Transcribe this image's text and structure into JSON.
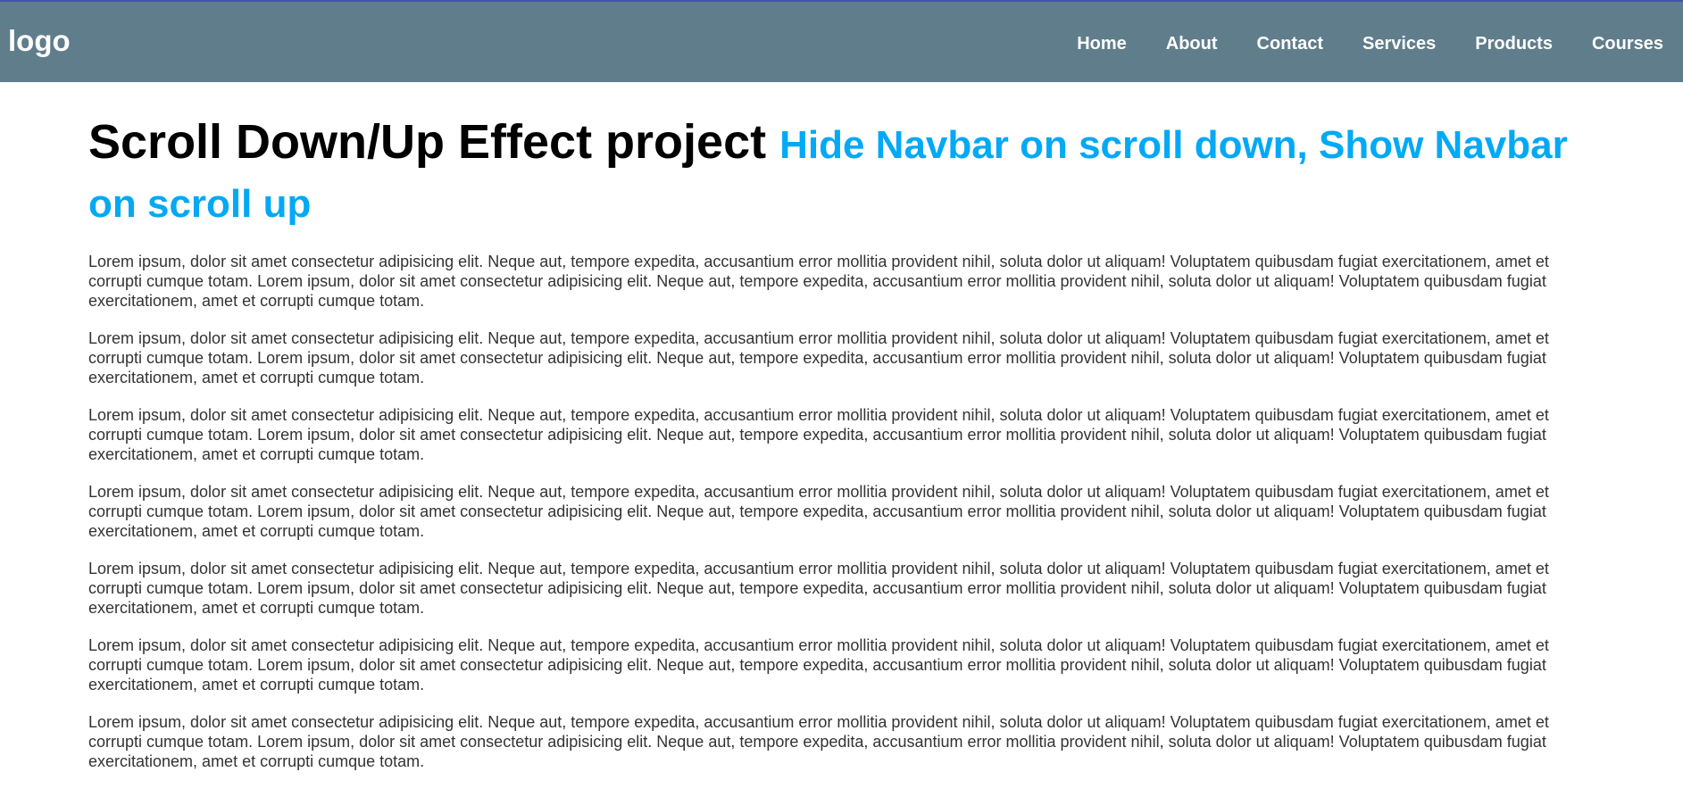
{
  "navbar": {
    "logo": "logo",
    "links": [
      "Home",
      "About",
      "Contact",
      "Services",
      "Products",
      "Courses"
    ]
  },
  "main": {
    "title": "Scroll Down/Up Effect project",
    "subtitle": "Hide Navbar on scroll down, Show Navbar on scroll up",
    "paragraphs": [
      "Lorem ipsum, dolor sit amet consectetur adipisicing elit. Neque aut, tempore expedita, accusantium error mollitia provident nihil, soluta dolor ut aliquam! Voluptatem quibusdam fugiat exercitationem, amet et corrupti cumque totam. Lorem ipsum, dolor sit amet consectetur adipisicing elit. Neque aut, tempore expedita, accusantium error mollitia provident nihil, soluta dolor ut aliquam! Voluptatem quibusdam fugiat exercitationem, amet et corrupti cumque totam.",
      "Lorem ipsum, dolor sit amet consectetur adipisicing elit. Neque aut, tempore expedita, accusantium error mollitia provident nihil, soluta dolor ut aliquam! Voluptatem quibusdam fugiat exercitationem, amet et corrupti cumque totam. Lorem ipsum, dolor sit amet consectetur adipisicing elit. Neque aut, tempore expedita, accusantium error mollitia provident nihil, soluta dolor ut aliquam! Voluptatem quibusdam fugiat exercitationem, amet et corrupti cumque totam.",
      "Lorem ipsum, dolor sit amet consectetur adipisicing elit. Neque aut, tempore expedita, accusantium error mollitia provident nihil, soluta dolor ut aliquam! Voluptatem quibusdam fugiat exercitationem, amet et corrupti cumque totam. Lorem ipsum, dolor sit amet consectetur adipisicing elit. Neque aut, tempore expedita, accusantium error mollitia provident nihil, soluta dolor ut aliquam! Voluptatem quibusdam fugiat exercitationem, amet et corrupti cumque totam.",
      "Lorem ipsum, dolor sit amet consectetur adipisicing elit. Neque aut, tempore expedita, accusantium error mollitia provident nihil, soluta dolor ut aliquam! Voluptatem quibusdam fugiat exercitationem, amet et corrupti cumque totam. Lorem ipsum, dolor sit amet consectetur adipisicing elit. Neque aut, tempore expedita, accusantium error mollitia provident nihil, soluta dolor ut aliquam! Voluptatem quibusdam fugiat exercitationem, amet et corrupti cumque totam.",
      "Lorem ipsum, dolor sit amet consectetur adipisicing elit. Neque aut, tempore expedita, accusantium error mollitia provident nihil, soluta dolor ut aliquam! Voluptatem quibusdam fugiat exercitationem, amet et corrupti cumque totam. Lorem ipsum, dolor sit amet consectetur adipisicing elit. Neque aut, tempore expedita, accusantium error mollitia provident nihil, soluta dolor ut aliquam! Voluptatem quibusdam fugiat exercitationem, amet et corrupti cumque totam.",
      "Lorem ipsum, dolor sit amet consectetur adipisicing elit. Neque aut, tempore expedita, accusantium error mollitia provident nihil, soluta dolor ut aliquam! Voluptatem quibusdam fugiat exercitationem, amet et corrupti cumque totam. Lorem ipsum, dolor sit amet consectetur adipisicing elit. Neque aut, tempore expedita, accusantium error mollitia provident nihil, soluta dolor ut aliquam! Voluptatem quibusdam fugiat exercitationem, amet et corrupti cumque totam.",
      "Lorem ipsum, dolor sit amet consectetur adipisicing elit. Neque aut, tempore expedita, accusantium error mollitia provident nihil, soluta dolor ut aliquam! Voluptatem quibusdam fugiat exercitationem, amet et corrupti cumque totam. Lorem ipsum, dolor sit amet consectetur adipisicing elit. Neque aut, tempore expedita, accusantium error mollitia provident nihil, soluta dolor ut aliquam! Voluptatem quibusdam fugiat exercitationem, amet et corrupti cumque totam."
    ]
  },
  "colors": {
    "navbar_bg": "#607d8b",
    "navbar_top_border": "#3f51b5",
    "accent": "#03a9f4",
    "body_text": "#333333"
  }
}
